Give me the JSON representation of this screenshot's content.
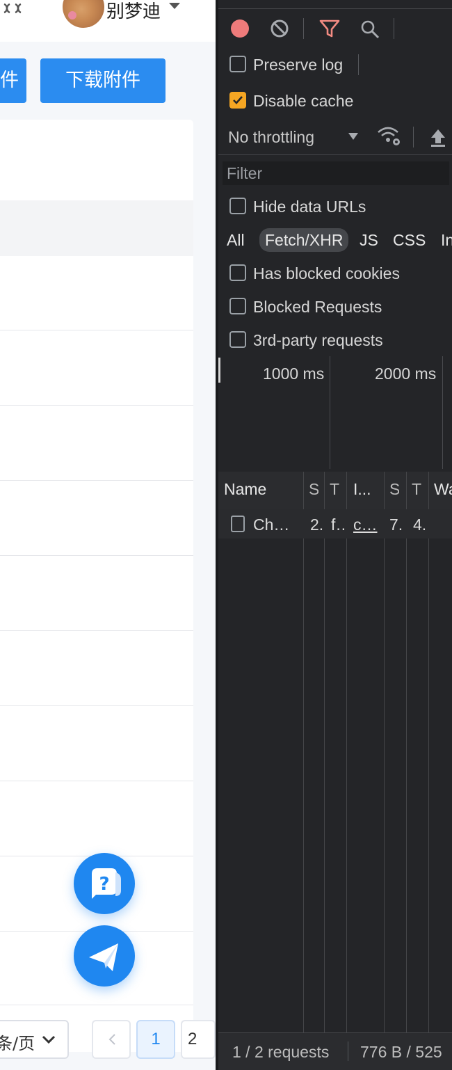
{
  "app": {
    "username": "别梦迪",
    "buttons": {
      "prev_partial": "件",
      "download": "下载附件"
    },
    "pagination": {
      "page_size_label": "条/页",
      "pages": [
        "1",
        "2"
      ]
    }
  },
  "devtools": {
    "checkboxes": {
      "preserve_log": "Preserve log",
      "disable_cache": "Disable cache",
      "hide_data_urls": "Hide data URLs",
      "has_blocked_cookies": "Has blocked cookies",
      "blocked_requests": "Blocked Requests",
      "third_party": "3rd-party requests"
    },
    "throttling": "No throttling",
    "filter_placeholder": "Filter",
    "type_filters": [
      "All",
      "Fetch/XHR",
      "JS",
      "CSS",
      "In"
    ],
    "timeline_ticks": [
      "1000 ms",
      "2000 ms"
    ],
    "columns": [
      "Name",
      "S",
      "T",
      "I...",
      "S",
      "T",
      "Wa"
    ],
    "rows": [
      {
        "name": "Ch…",
        "c1": "2.",
        "c2": "f…",
        "c3": "c…",
        "c4": "7.",
        "c5": "4."
      }
    ],
    "status": {
      "requests": "1 / 2 requests",
      "transferred": "776 B / 525"
    },
    "colors": {
      "record": "#ee7b7b",
      "checkbox_checked": "#f5a623",
      "filter_active": "#f28b82"
    }
  }
}
